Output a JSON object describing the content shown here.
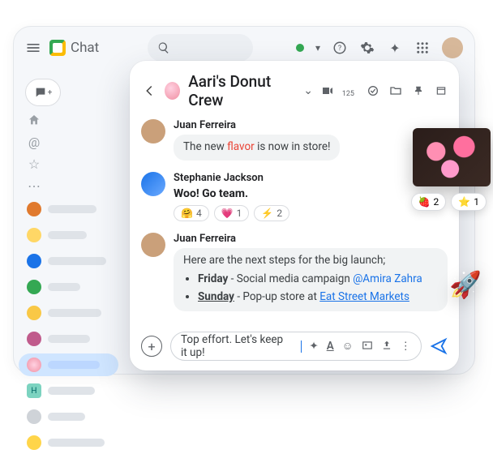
{
  "brand": "Chat",
  "header": {
    "status": "active",
    "members_count": "125"
  },
  "space": {
    "title": "Aari's Donut Crew"
  },
  "sidebar": {
    "selected_index": 6
  },
  "messages": {
    "m1": {
      "sender": "Juan Ferreira",
      "pre": "The new ",
      "hot": "flavor",
      "post": " is now in store!"
    },
    "m2": {
      "sender": "Stephanie Jackson",
      "text": "Woo! Go team.",
      "reactions": {
        "r1": {
          "emoji": "🤗",
          "count": "4"
        },
        "r2": {
          "emoji": "💗",
          "count": "1"
        },
        "r3": {
          "emoji": "⚡",
          "count": "2"
        }
      }
    },
    "m3": {
      "sender": "Juan Ferreira",
      "intro": "Here are the next steps for the big launch;",
      "li1": {
        "day": "Friday",
        "rest": " - Social media campaign ",
        "mention": "@Amira Zahra"
      },
      "li2": {
        "day": "Sunday",
        "rest": " - Pop-up store at ",
        "link": "Eat Street Markets"
      }
    }
  },
  "compose": {
    "value": "Top effort. Let's keep it up!"
  },
  "floating_reactions": {
    "a": {
      "emoji": "🍓",
      "count": "2"
    },
    "b": {
      "emoji": "⭐",
      "count": "1"
    }
  },
  "floating_emoji": "🚀"
}
